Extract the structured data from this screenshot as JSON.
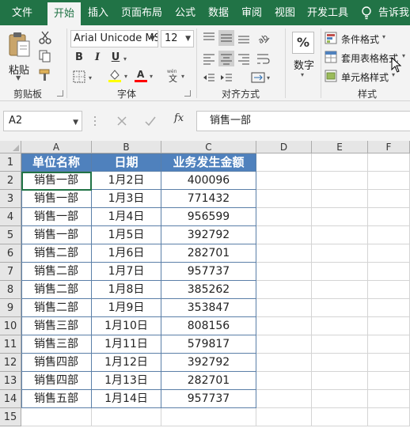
{
  "tabs": {
    "file": "文件",
    "home": "开始",
    "insert": "插入",
    "layout": "页面布局",
    "formula": "公式",
    "data": "数据",
    "review": "审阅",
    "view": "视图",
    "dev": "开发工具",
    "tell": "告诉我"
  },
  "ribbon": {
    "clipboard": {
      "paste": "粘贴",
      "group": "剪贴板"
    },
    "font": {
      "name": "Arial Unicode MS",
      "size": "12",
      "bold": "B",
      "italic": "I",
      "underline": "U",
      "group": "字体"
    },
    "alignment": {
      "group": "对齐方式"
    },
    "number": {
      "percent": "%",
      "label": "数字"
    },
    "styles": {
      "conditional": "条件格式",
      "table": "套用表格格式",
      "cell": "单元格样式",
      "group": "样式"
    },
    "accent_color": "#217346",
    "highlight_color": "#ffff00",
    "font_color": "#ff0000"
  },
  "formula_bar": {
    "name_box": "A2",
    "fx": "fx",
    "content": "销售一部"
  },
  "grid": {
    "columns": [
      "A",
      "B",
      "C",
      "D",
      "E",
      "F"
    ],
    "rows": [
      "1",
      "2",
      "3",
      "4",
      "5",
      "6",
      "7",
      "8",
      "9",
      "10",
      "11",
      "12",
      "13",
      "14",
      "15"
    ],
    "table": {
      "headers": [
        "单位名称",
        "日期",
        "业务发生金额"
      ],
      "header_color": "#4f81bd",
      "rows": [
        [
          "销售一部",
          "1月2日",
          "400096"
        ],
        [
          "销售一部",
          "1月3日",
          "771432"
        ],
        [
          "销售一部",
          "1月4日",
          "956599"
        ],
        [
          "销售一部",
          "1月5日",
          "392792"
        ],
        [
          "销售二部",
          "1月6日",
          "282701"
        ],
        [
          "销售二部",
          "1月7日",
          "957737"
        ],
        [
          "销售二部",
          "1月8日",
          "385262"
        ],
        [
          "销售二部",
          "1月9日",
          "353847"
        ],
        [
          "销售三部",
          "1月10日",
          "808156"
        ],
        [
          "销售三部",
          "1月11日",
          "579817"
        ],
        [
          "销售四部",
          "1月12日",
          "392792"
        ],
        [
          "销售四部",
          "1月13日",
          "282701"
        ],
        [
          "销售五部",
          "1月14日",
          "957737"
        ]
      ]
    }
  }
}
